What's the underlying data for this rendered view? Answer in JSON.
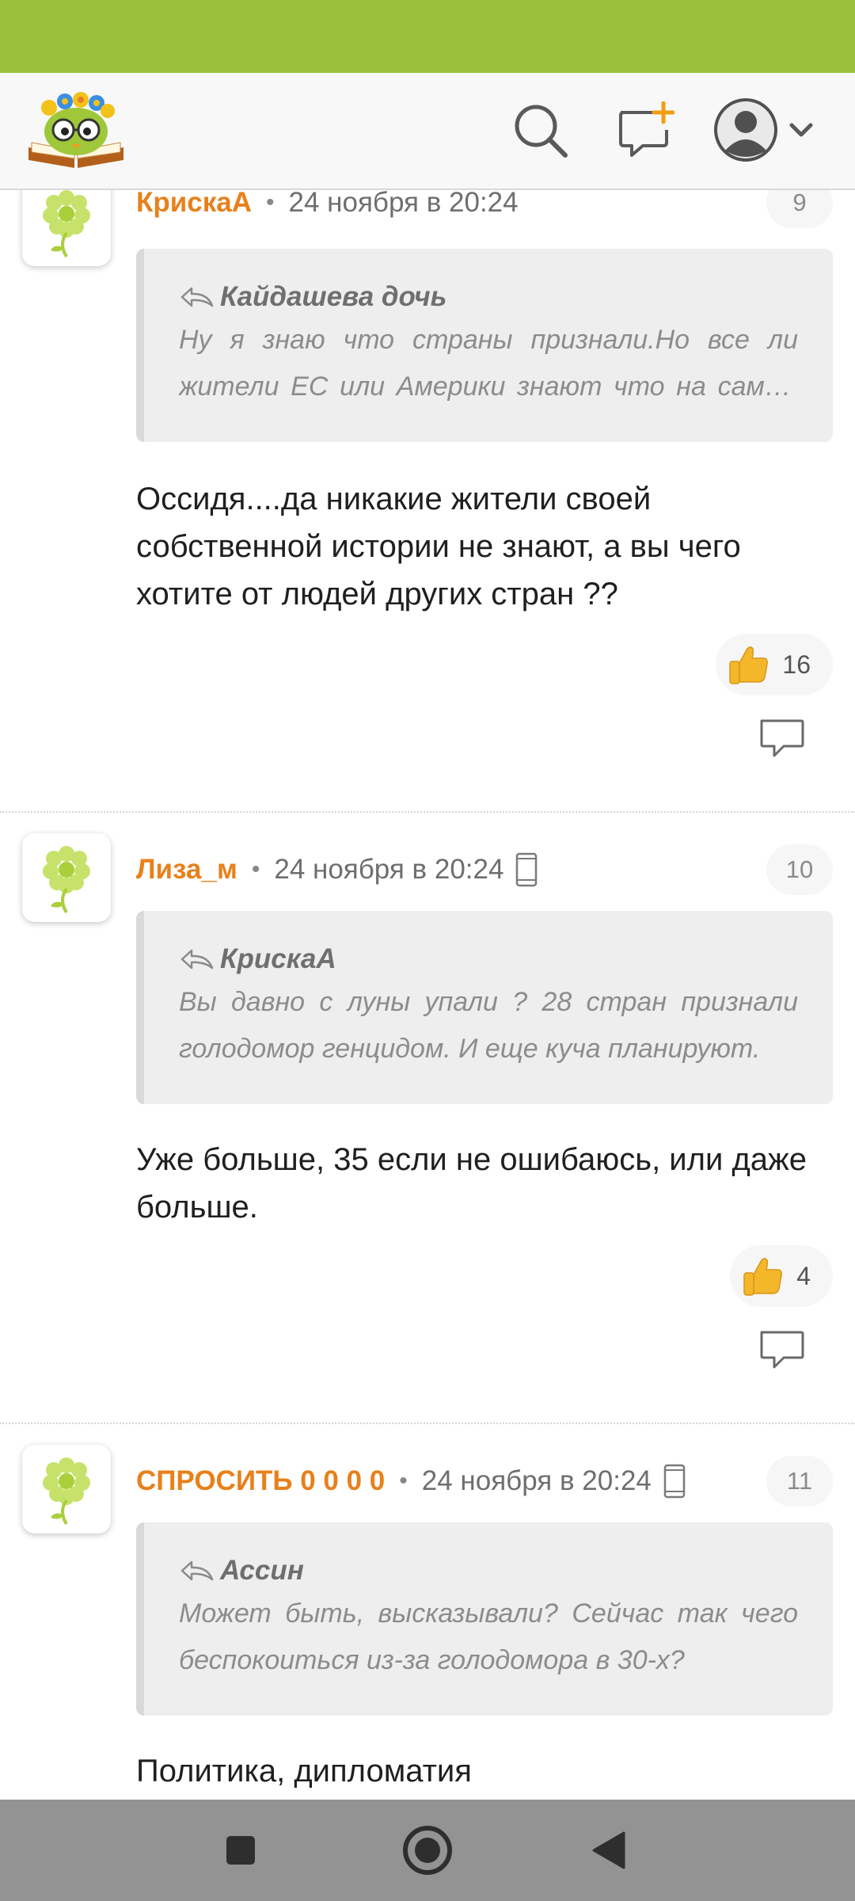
{
  "colors": {
    "status_bar": "#9bc03b",
    "author": "#e8801b",
    "nav_bar": "#939393"
  },
  "header": {
    "logo_icon": "owl-reading-book-logo",
    "search_icon": "search-icon",
    "new_question_icon": "new-question-icon",
    "avatar_icon": "user-avatar-icon"
  },
  "comments": [
    {
      "author": "КрискаА",
      "date": "24 ноября в 20:24",
      "number": "9",
      "mobile": false,
      "quote_author": "Кайдашева дочь",
      "quote_text": "Ну я знаю что страны признали.Но все ли жители ЕС или Америки знают что на самом деле произошло",
      "text": "Оссидя....да никакие жители своей собственной истории не знают, а вы чего хотите от людей других стран ??",
      "likes": "16"
    },
    {
      "author": "Лиза_м",
      "date": "24 ноября в 20:24",
      "number": "10",
      "mobile": true,
      "quote_author": "КрискаА",
      "quote_text": "Вы давно с луны упали ? 28 стран признали голодомор генцидом. И еще куча планируют.",
      "text": "Уже больше, 35 если не ошибаюсь, или даже больше.",
      "likes": "4"
    },
    {
      "author": "СПРОСИТЬ 0 0 0 0",
      "date": "24 ноября в 20:24",
      "number": "11",
      "mobile": true,
      "quote_author": "Ассин",
      "quote_text": "Может быть, высказывали? Сейчас так чего беспокоиться из-за голодомора в 30-х?",
      "text": "Политика, дипломатия",
      "likes": ""
    }
  ],
  "nav": {
    "recents_icon": "square-icon",
    "home_icon": "circle-icon",
    "back_icon": "triangle-back-icon"
  }
}
